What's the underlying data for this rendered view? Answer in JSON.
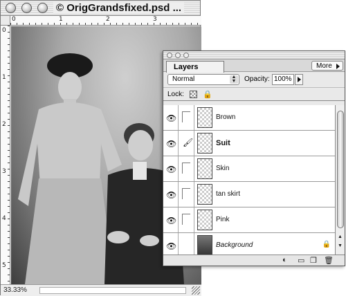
{
  "document": {
    "title": "© OrigGrandsfixed.psd ...",
    "zoom": "33.33%",
    "ruler_top_labels": [
      "0",
      "1",
      "2",
      "3"
    ],
    "ruler_left_labels": [
      "0",
      "1",
      "2",
      "3",
      "4",
      "5"
    ]
  },
  "layers_panel": {
    "tab_label": "Layers",
    "more_label": "More",
    "blend_mode": "Normal",
    "opacity_label": "Opacity:",
    "opacity_value": "100%",
    "lock_label": "Lock:",
    "layers": [
      {
        "name": "Brown",
        "visible": true,
        "active": false
      },
      {
        "name": "Suit",
        "visible": true,
        "active": true
      },
      {
        "name": "Skin",
        "visible": true,
        "active": false
      },
      {
        "name": "tan skirt",
        "visible": true,
        "active": false
      },
      {
        "name": "Pink",
        "visible": true,
        "active": false
      },
      {
        "name": "Background",
        "visible": true,
        "active": false,
        "locked": true
      }
    ]
  }
}
